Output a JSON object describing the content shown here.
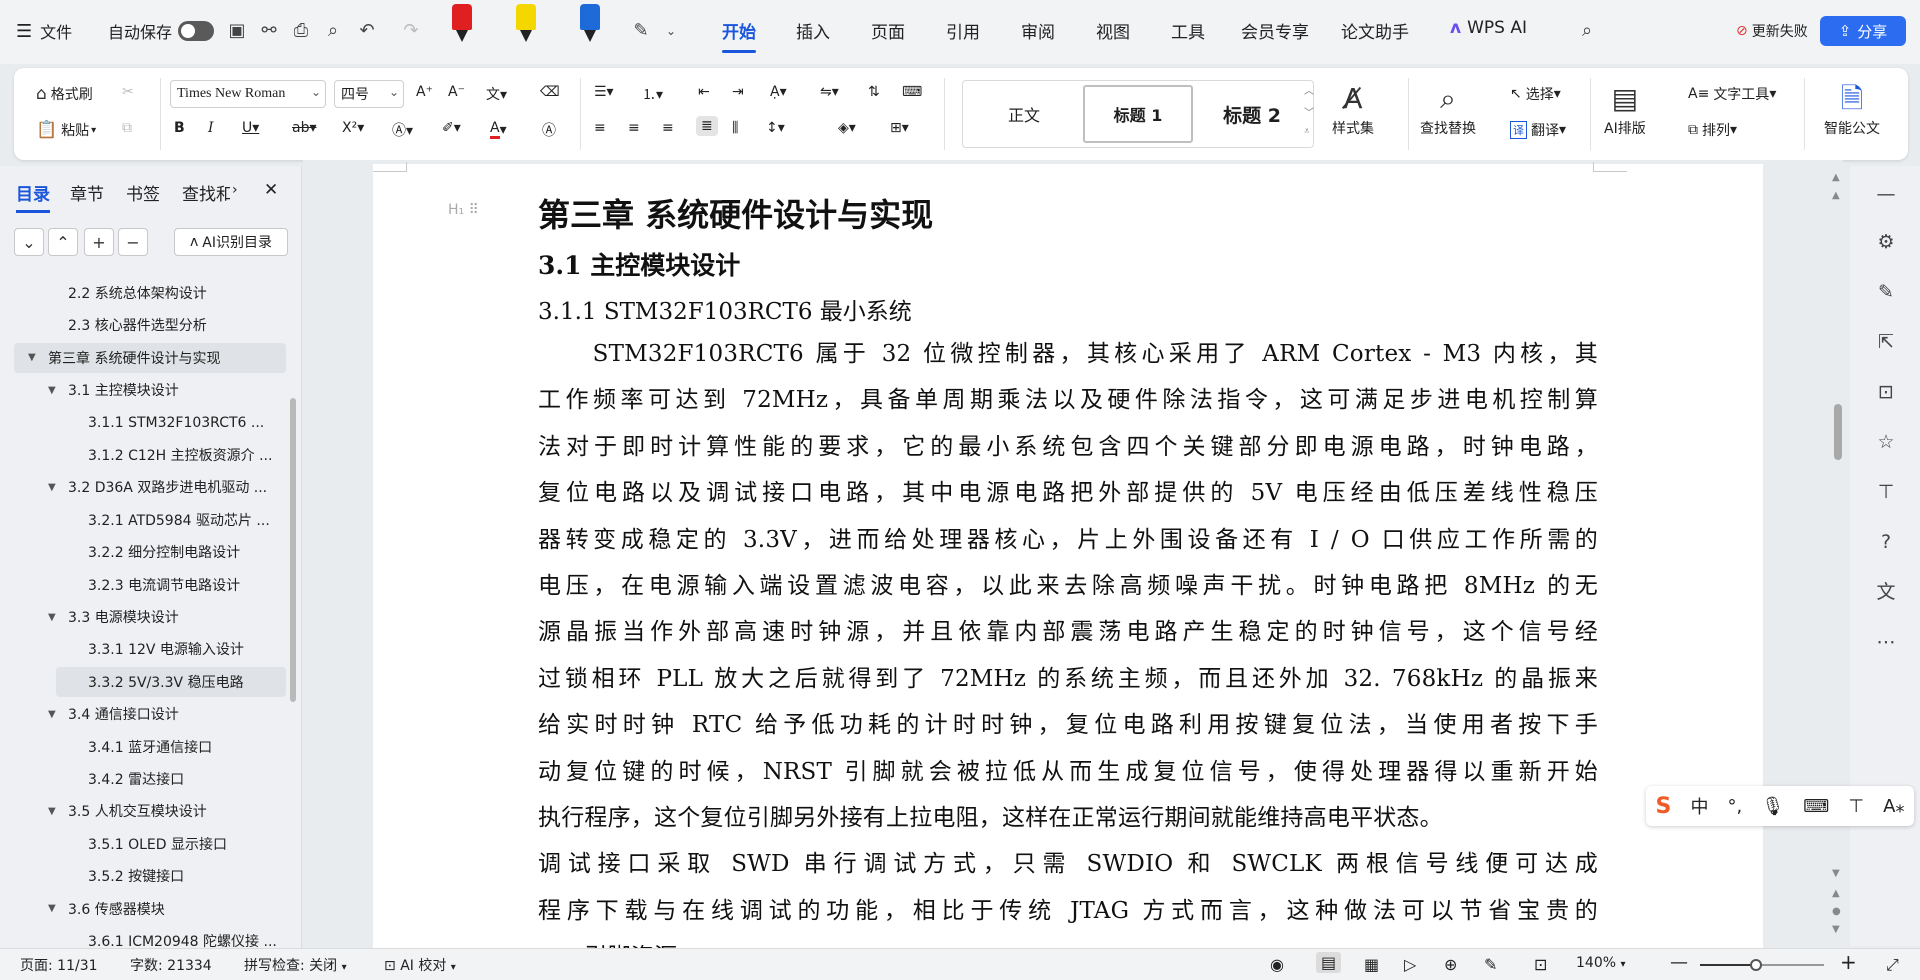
{
  "topbar": {
    "file": "文件",
    "autosave": "自动保存",
    "tabs": [
      "开始",
      "插入",
      "页面",
      "引用",
      "审阅",
      "视图",
      "工具",
      "会员专享",
      "论文助手"
    ],
    "active_tab": "开始",
    "wps_ai": "WPS AI",
    "update_failed": "更新失败",
    "share": "分享",
    "marker_colors": [
      "#e02020",
      "#f5d700",
      "#1e6ad8"
    ]
  },
  "ribbon": {
    "format_painter": "格式刷",
    "paste": "粘贴",
    "font_name": "Times New Roman",
    "font_size": "四号",
    "styles": [
      "正文",
      "标题 1",
      "标题 2"
    ],
    "style_set": "样式集",
    "find_replace": "查找替换",
    "select": "选择",
    "translate": "翻译",
    "ai_layout": "AI排版",
    "text_tools": "文字工具",
    "arrange": "排列",
    "smart_doc": "智能公文"
  },
  "sidebar": {
    "tabs": [
      "目录",
      "章节",
      "书签",
      "查找和"
    ],
    "ai_toc": "AI识别目录",
    "toc": [
      {
        "label": "2.2  系统总体架构设计",
        "level": 2,
        "tri": ""
      },
      {
        "label": "2.3  核心器件选型分析",
        "level": 2,
        "tri": ""
      },
      {
        "label": "第三章  系统硬件设计与实现",
        "level": 1,
        "tri": "▼",
        "hl": true
      },
      {
        "label": "3.1  主控模块设计",
        "level": 2,
        "tri": "▼"
      },
      {
        "label": "3.1.1 STM32F103RCT6 ...",
        "level": 3,
        "tri": ""
      },
      {
        "label": "3.1.2 C12H 主控板资源介 ...",
        "level": 3,
        "tri": ""
      },
      {
        "label": "3.2 D36A 双路步进电机驱动 ...",
        "level": 2,
        "tri": "▼"
      },
      {
        "label": "3.2.1 ATD5984 驱动芯片 ...",
        "level": 3,
        "tri": ""
      },
      {
        "label": "3.2.2  细分控制电路设计",
        "level": 3,
        "tri": ""
      },
      {
        "label": "3.2.3  电流调节电路设计",
        "level": 3,
        "tri": ""
      },
      {
        "label": "3.3  电源模块设计",
        "level": 2,
        "tri": "▼"
      },
      {
        "label": "3.3.1 12V 电源输入设计",
        "level": 3,
        "tri": ""
      },
      {
        "label": "3.3.2 5V/3.3V 稳压电路",
        "level": 3,
        "tri": "",
        "hl": true
      },
      {
        "label": "3.4  通信接口设计",
        "level": 2,
        "tri": "▼"
      },
      {
        "label": "3.4.1  蓝牙通信接口",
        "level": 3,
        "tri": ""
      },
      {
        "label": "3.4.2  雷达接口",
        "level": 3,
        "tri": ""
      },
      {
        "label": "3.5  人机交互模块设计",
        "level": 2,
        "tri": "▼"
      },
      {
        "label": "3.5.1 OLED 显示接口",
        "level": 3,
        "tri": ""
      },
      {
        "label": "3.5.2  按键接口",
        "level": 3,
        "tri": ""
      },
      {
        "label": "3.6  传感器模块",
        "level": 2,
        "tri": "▼"
      },
      {
        "label": "3.6.1 ICM20948 陀螺仪接 ...",
        "level": 3,
        "tri": ""
      }
    ]
  },
  "doc": {
    "h1": "第三章  系统硬件设计与实现",
    "h2": "3.1  主控模块设计",
    "h3": "3.1.1 STM32F103RCT6 最小系统",
    "lines": [
      "　　STM32F103RCT6 属于 32 位微控制器，其核心采用了 ARM  Cortex  -  M3 内核，其",
      "工作频率可达到 72MHz，具备单周期乘法以及硬件除法指令，这可满足步进电机控制算",
      "法对于即时计算性能的要求，它的最小系统包含四个关键部分即电源电路，时钟电路，",
      "复位电路以及调试接口电路，其中电源电路把外部提供的 5V 电压经由低压差线性稳压",
      "器转变成稳定的 3.3V，进而给处理器核心，片上外围设备还有 I  /  O  口供应工作所需的",
      "电压，在电源输入端设置滤波电容，以此来去除高频噪声干扰。时钟电路把 8MHz 的无",
      "源晶振当作外部高速时钟源，并且依靠内部震荡电路产生稳定的时钟信号，这个信号经",
      "过锁相环 PLL 放大之后就得到了 72MHz 的系统主频，而且还外加 32. 768kHz 的晶振来",
      "给实时时钟 RTC 给予低功耗的计时时钟，复位电路利用按键复位法，当使用者按下手",
      "动复位键的时候，NRST 引脚就会被拉低从而生成复位信号，使得处理器得以重新开始",
      "执行程序，这个复位引脚另外接有上拉电阻，这样在正常运行期间就能维持高电平状态。",
      " 调试接口采取  SWD  串行调试方式，只需  SWDIO  和  SWCLK  两根信号线便可达成",
      "程序下载与在线调试的功能，相比于传统  JTAG  方式而言，这种做法可以节省宝贵的",
      "　　引脚资源。"
    ]
  },
  "ime": {
    "cn": "中"
  },
  "status": {
    "page": "页面: 11/31",
    "words": "字数: 21334",
    "spell": "拼写检查: 关闭",
    "ai_check": "AI 校对",
    "zoom": "140%",
    "zoom_fraction": 0.45
  }
}
